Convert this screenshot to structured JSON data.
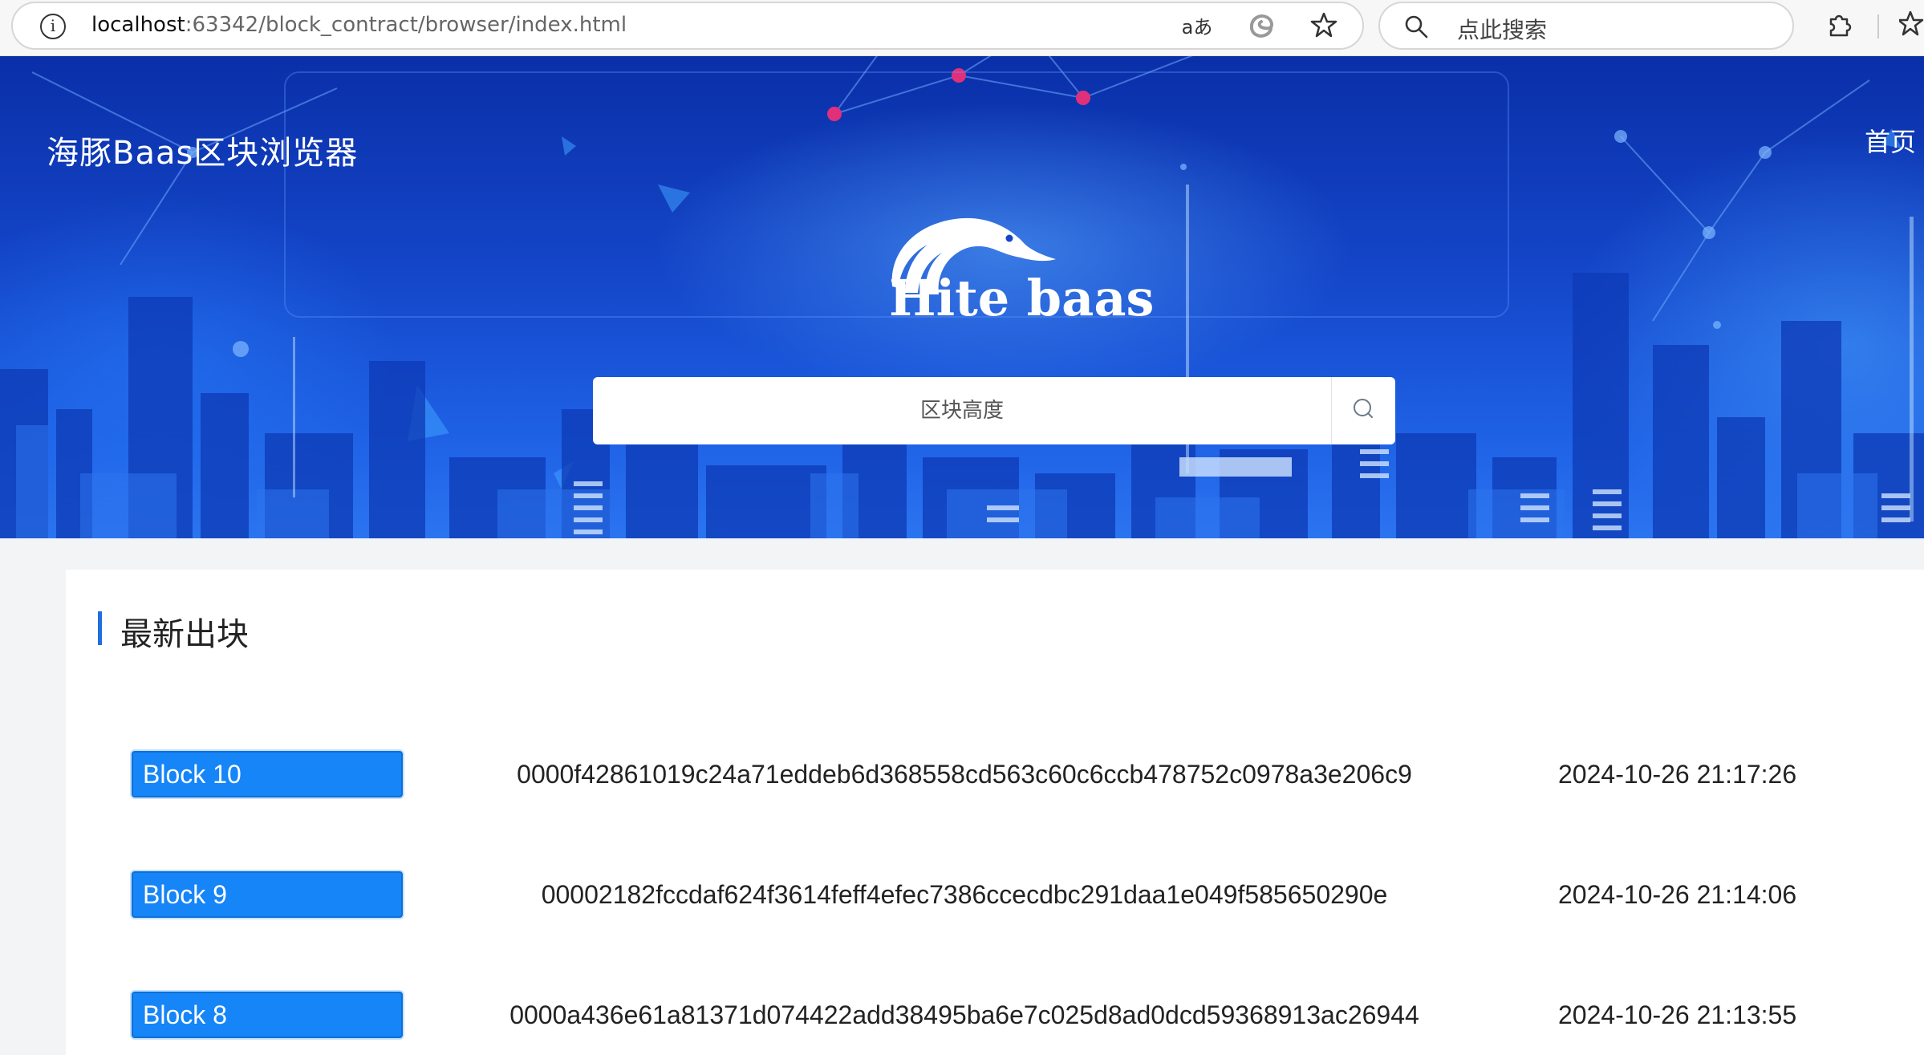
{
  "browser": {
    "url_host": "localhost",
    "url_rest": ":63342/block_contract/browser/index.html",
    "search_placeholder": "点此搜索",
    "translate_icon_label": "aあ"
  },
  "header": {
    "site_title": "海豚Baas区块浏览器",
    "nav_home": "首页"
  },
  "hero": {
    "logo_text": "Hite baas",
    "search_placeholder": "区块高度"
  },
  "latest": {
    "title": "最新出块",
    "blocks": [
      {
        "label": "Block 10",
        "hash": "0000f42861019c24a71eddeb6d368558cd563c60c6ccb478752c0978a3e206c9",
        "time": "2024-10-26 21:17:26"
      },
      {
        "label": "Block 9",
        "hash": "00002182fccdaf624f3614feff4efec7386ccecdbc291daa1e049f585650290e",
        "time": "2024-10-26 21:14:06"
      },
      {
        "label": "Block 8",
        "hash": "0000a436e61a81371d074422add38495ba6e7c025d8ad0dcd59368913ac26944",
        "time": "2024-10-26 21:13:55"
      }
    ]
  },
  "colors": {
    "accent": "#1585f8",
    "section_bar": "#1f6fe0",
    "hero_bg": "#1446c9"
  }
}
